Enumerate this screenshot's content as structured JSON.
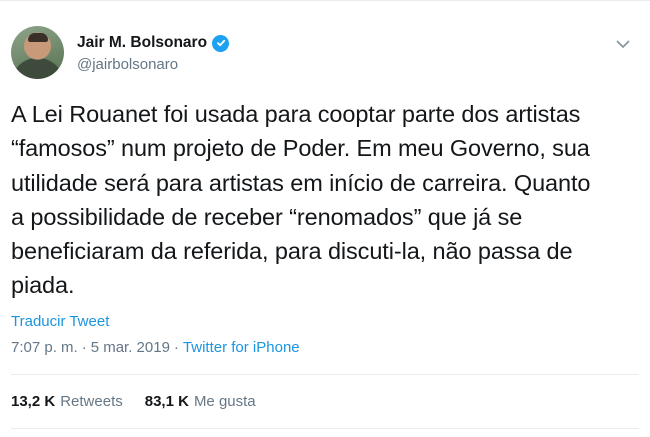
{
  "user": {
    "display_name": "Jair M. Bolsonaro",
    "handle": "@jairbolsonaro",
    "verified": true
  },
  "tweet": {
    "text": "A Lei Rouanet foi usada para cooptar parte dos artistas\n“famosos” num projeto de Poder. Em meu Governo, sua\nutilidade será para artistas em início de carreira. Quanto\na possibilidade de receber “renomados” que já se\nbeneficiaram da referida, para discuti-la, não passa de\npiada.",
    "translate_label": "Traducir Tweet",
    "time": "7:07 p. m.",
    "separator": "·",
    "date": "5 mar. 2019",
    "source": "Twitter for iPhone"
  },
  "stats": {
    "retweets_count": "13,2 K",
    "retweets_label": "Retweets",
    "likes_count": "83,1 K",
    "likes_label": "Me gusta"
  },
  "colors": {
    "accent": "#1b95e0",
    "verified": "#1da1f2",
    "text_primary": "#14171a",
    "text_secondary": "#657786",
    "divider": "#e6ecf0"
  },
  "icons": {
    "verified": "verified-badge-icon",
    "menu": "chevron-down-icon"
  }
}
